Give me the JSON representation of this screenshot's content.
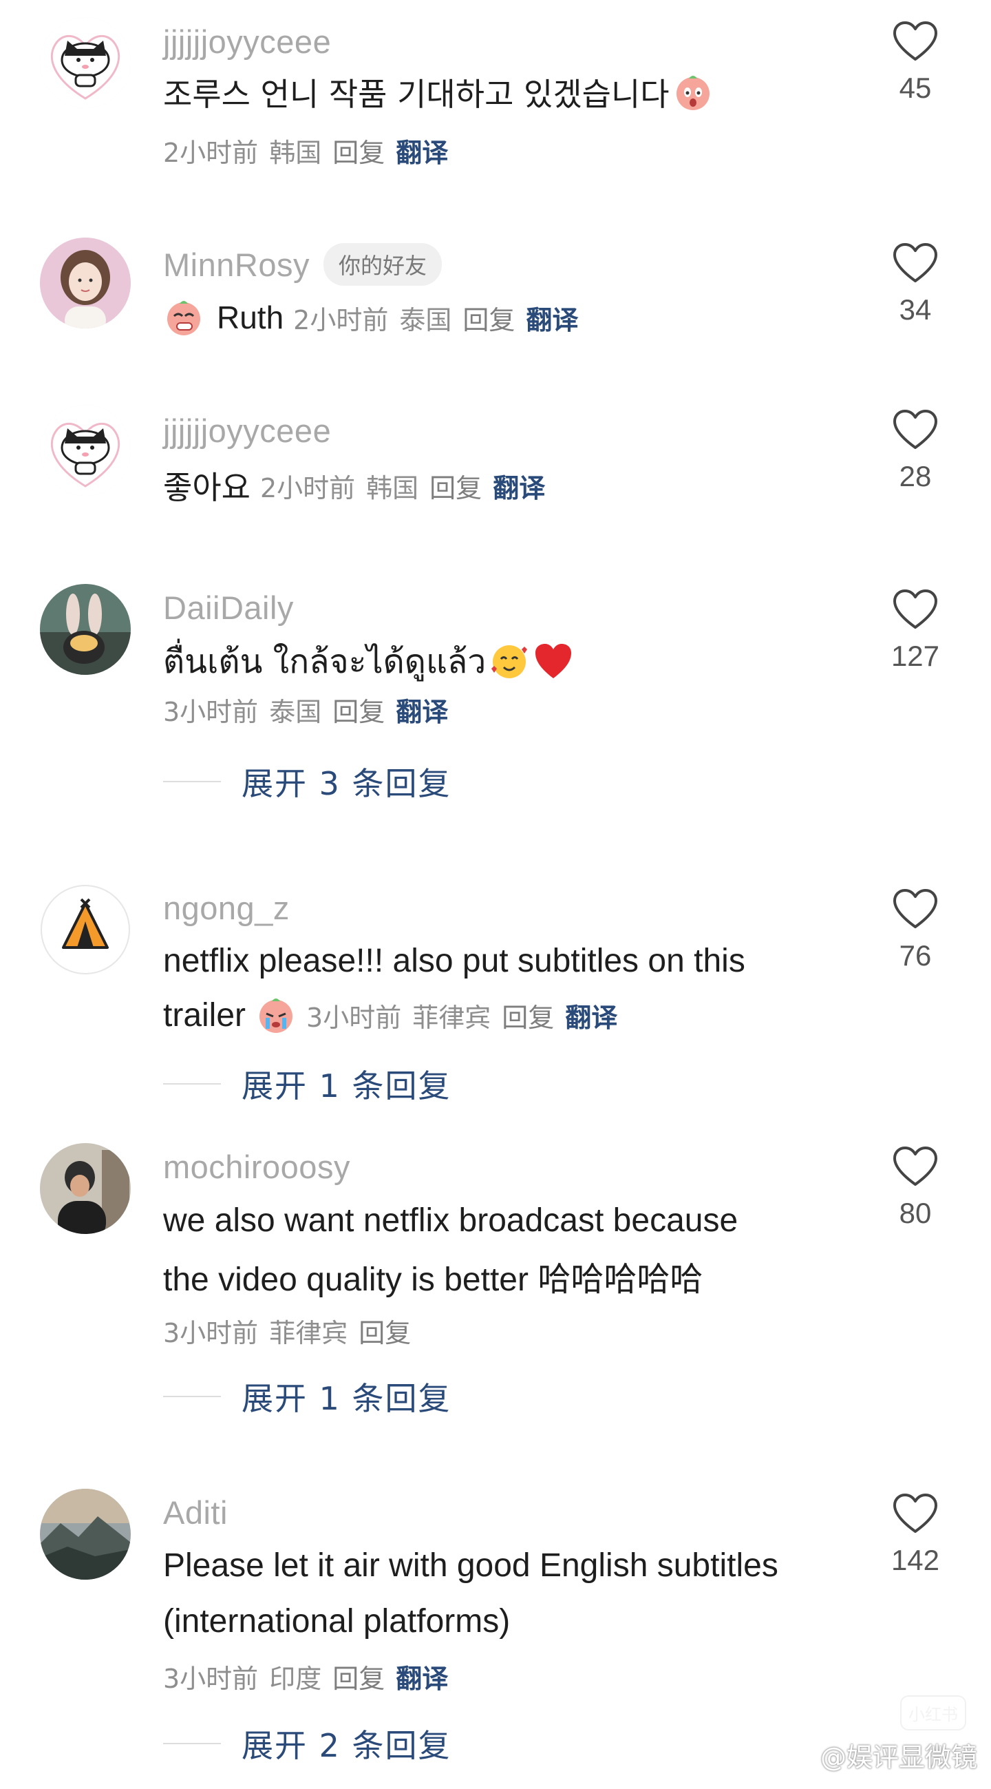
{
  "comments": [
    {
      "username": "jjjjjjoyyceee",
      "text": "조루스 언니 작품 기대하고 있겠습니다",
      "time": "2小时前",
      "location": "韩国",
      "reply_label": "回复",
      "translate_label": "翻译",
      "likes": "45",
      "avatar": "cat-sticker",
      "emoji": "shocked-face-emoji"
    },
    {
      "username": "MinnRosy",
      "badge": "你的好友",
      "text": "Ruth",
      "time": "2小时前",
      "location": "泰国",
      "reply_label": "回复",
      "translate_label": "翻译",
      "likes": "34",
      "avatar": "girl-photo",
      "emoji": "blushing-face-emoji"
    },
    {
      "username": "jjjjjjoyyceee",
      "text": "좋아요",
      "time": "2小时前",
      "location": "韩国",
      "reply_label": "回复",
      "translate_label": "翻译",
      "likes": "28",
      "avatar": "cat-sticker"
    },
    {
      "username": "DaiiDaily",
      "text": "ตื่นเต้น ใกล้จะได้ดูแล้ว",
      "time": "3小时前",
      "location": "泰国",
      "reply_label": "回复",
      "translate_label": "翻译",
      "likes": "127",
      "avatar": "bunny-ears-photo",
      "emoji": [
        "smiling-hearts-emoji",
        "red-heart-emoji"
      ],
      "expand_label": "展开 3 条回复"
    },
    {
      "username": "ngong_z",
      "text_lines": [
        "netflix please!!! also put subtitles on this",
        "trailer"
      ],
      "time": "3小时前",
      "location": "菲律宾",
      "reply_label": "回复",
      "translate_label": "翻译",
      "likes": "76",
      "avatar": "tent-icon",
      "emoji": "crying-face-emoji",
      "expand_label": "展开 1 条回复"
    },
    {
      "username": "mochirooosy",
      "text_lines": [
        "we also want netflix broadcast because",
        "the video quality is better 哈哈哈哈哈"
      ],
      "time": "3小时前",
      "location": "菲律宾",
      "reply_label": "回复",
      "likes": "80",
      "avatar": "person-photo",
      "expand_label": "展开 1 条回复"
    },
    {
      "username": "Aditi",
      "text_lines": [
        "Please let it air with good English subtitles",
        "(international platforms)"
      ],
      "time": "3小时前",
      "location": "印度",
      "reply_label": "回复",
      "translate_label": "翻译",
      "likes": "142",
      "avatar": "mountain-photo",
      "expand_label": "展开 2 条回复"
    }
  ],
  "watermark": {
    "text": "@娱评显微镜",
    "icon": "weibo-icon",
    "small_mark": "小红书"
  },
  "colors": {
    "username": "#a8a8a8",
    "meta": "#8e8e8e",
    "link": "#2a4a7a",
    "body_text": "#1e1e1e"
  }
}
